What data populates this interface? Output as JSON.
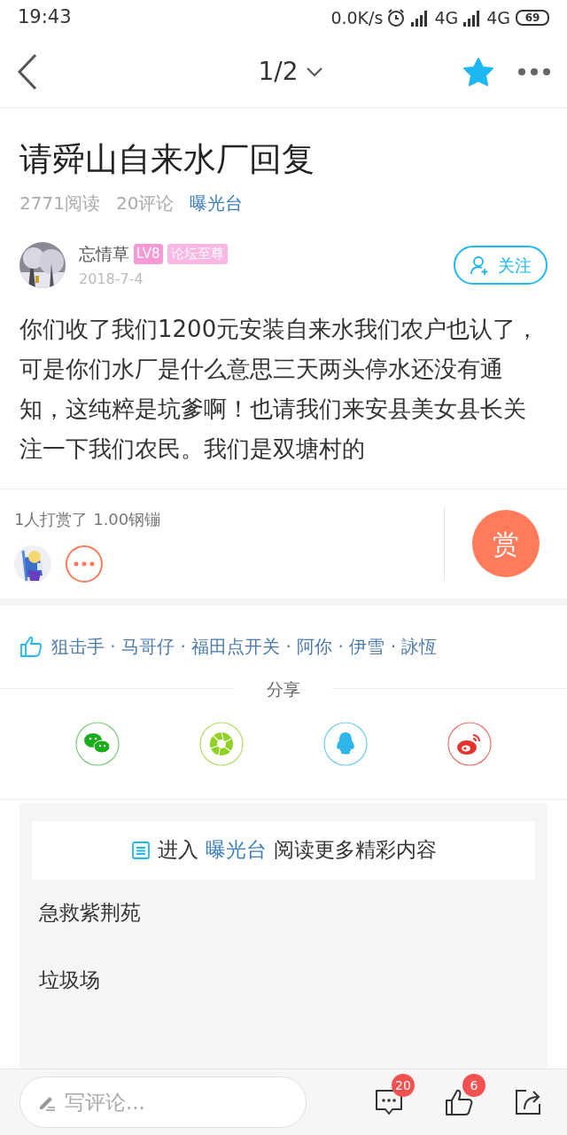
{
  "status_bar": {
    "time": "19:43",
    "speed": "0.0K/s",
    "network_1": "4G",
    "network_2": "4G",
    "battery": "69"
  },
  "nav": {
    "page": "1/2",
    "favorited": true
  },
  "post": {
    "title": "请舜山自来水厂回复",
    "reads": "2771阅读",
    "comments": "20评论",
    "board": "曝光台",
    "author": {
      "name": "忘情草",
      "level": "LV8",
      "rank": "论坛至尊",
      "date": "2018-7-4",
      "follow": "关注"
    },
    "body": "你们收了我们1200元安装自来水我们农户也认了，可是你们水厂是什么意思三天两头停水还没有通知，这纯粹是坑爹啊！也请我们来安县美女县长关注一下我们农民。我们是双塘村的"
  },
  "reward": {
    "summary": "1人打赏了 1.00钢镚",
    "button": "赏"
  },
  "likes": "狙击手 · 马哥仔 · 福田点开关 · 阿你 · 伊雪 · 詠恆",
  "share": {
    "label": "分享",
    "targets": [
      {
        "kind": "wechat",
        "color": "#1aad19"
      },
      {
        "kind": "moments",
        "color": "#8fd124"
      },
      {
        "kind": "qq",
        "color": "#2fb6e8"
      },
      {
        "kind": "weibo",
        "color": "#e6322d"
      }
    ]
  },
  "more": {
    "prefix": "进入",
    "board": "曝光台",
    "suffix": "阅读更多精彩内容",
    "items": [
      "急救紫荆苑",
      "垃圾场"
    ]
  },
  "bottom_bar": {
    "placeholder": "写评论...",
    "comment_count": "20",
    "like_count": "6"
  }
}
